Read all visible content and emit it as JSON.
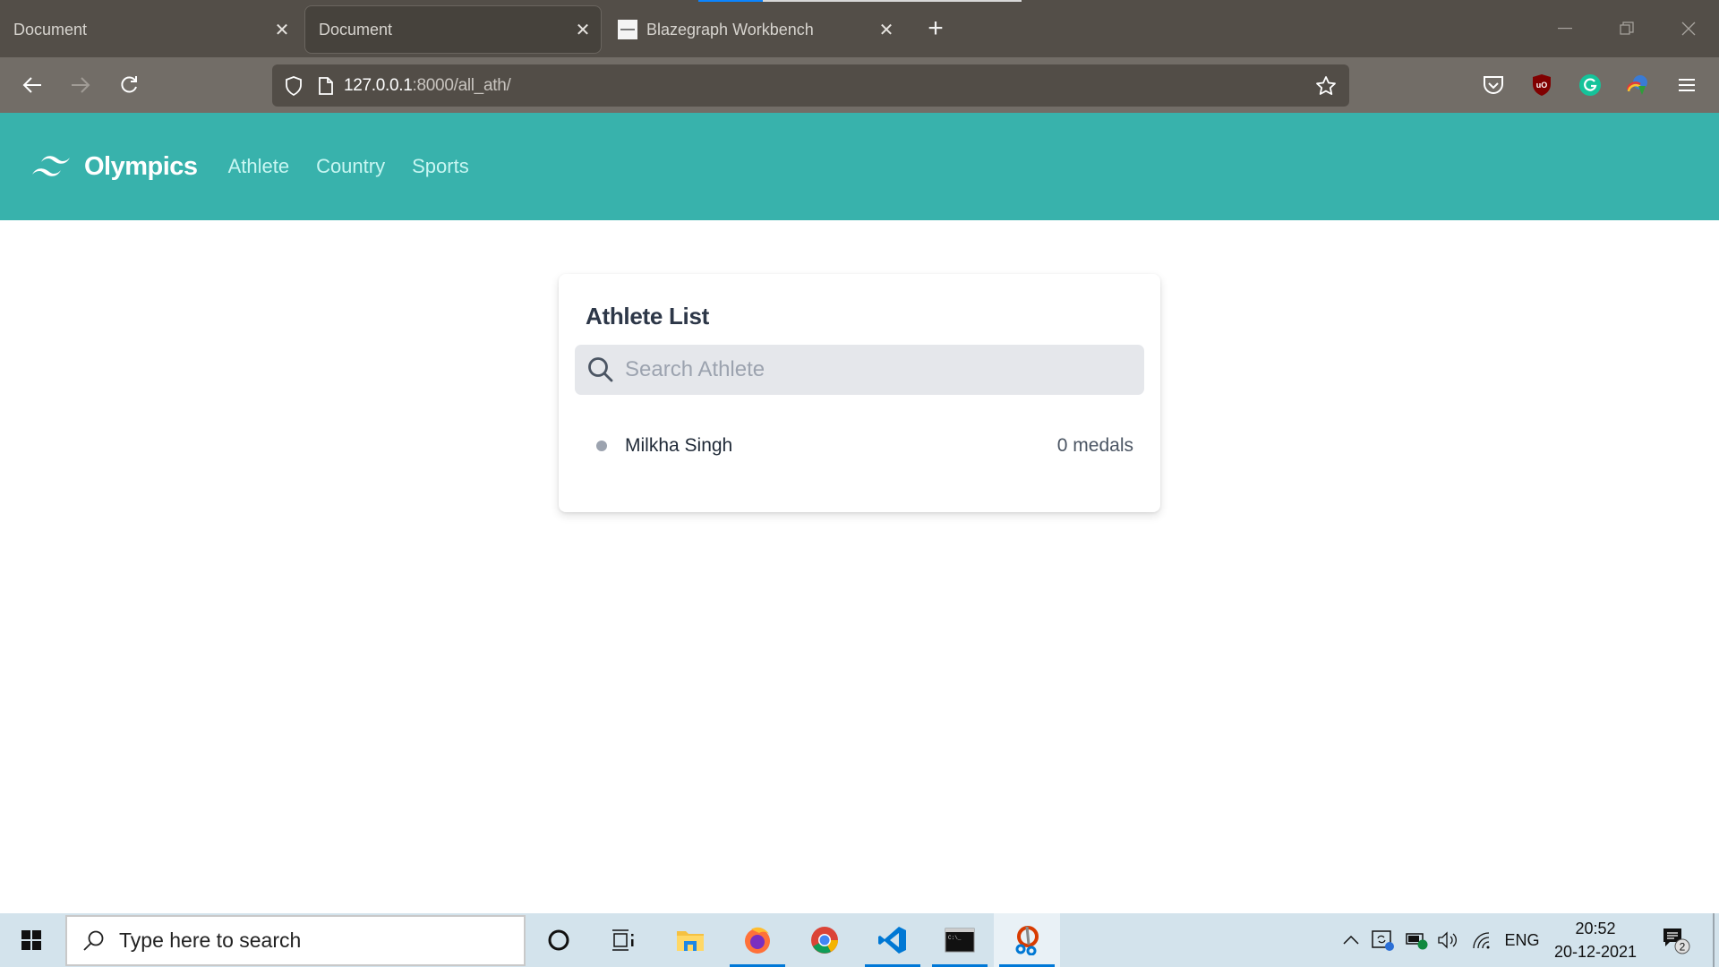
{
  "browser": {
    "load_progress": 0.2,
    "tabs": [
      {
        "title": "Document",
        "active": false
      },
      {
        "title": "Document",
        "active": true
      },
      {
        "title": "Blazegraph Workbench",
        "active": false
      }
    ],
    "new_tab_label": "+",
    "url_host": "127.0.0.1",
    "url_rest": ":8000/all_ath/",
    "window_controls": [
      "minimize",
      "restore",
      "close"
    ],
    "extensions": [
      "pocket-icon",
      "ublock-origin-icon",
      "grammarly-icon",
      "idm-icon",
      "menu-icon"
    ]
  },
  "header": {
    "brand": "Olympics",
    "brand_color": "#38b2ac",
    "nav": [
      "Athlete",
      "Country",
      "Sports"
    ]
  },
  "card": {
    "title": "Athlete List",
    "search_placeholder": "Search Athlete",
    "search_value": "",
    "athletes": [
      {
        "name": "Milkha Singh",
        "medals": "0 medals"
      }
    ]
  },
  "taskbar": {
    "search_placeholder": "Type here to search",
    "apps": [
      "cortana",
      "task-view",
      "file-explorer",
      "firefox",
      "chrome",
      "vscode",
      "terminal",
      "snipping-tool"
    ],
    "language": "ENG",
    "time": "20:52",
    "date": "20-12-2021",
    "notification_count": "2"
  }
}
